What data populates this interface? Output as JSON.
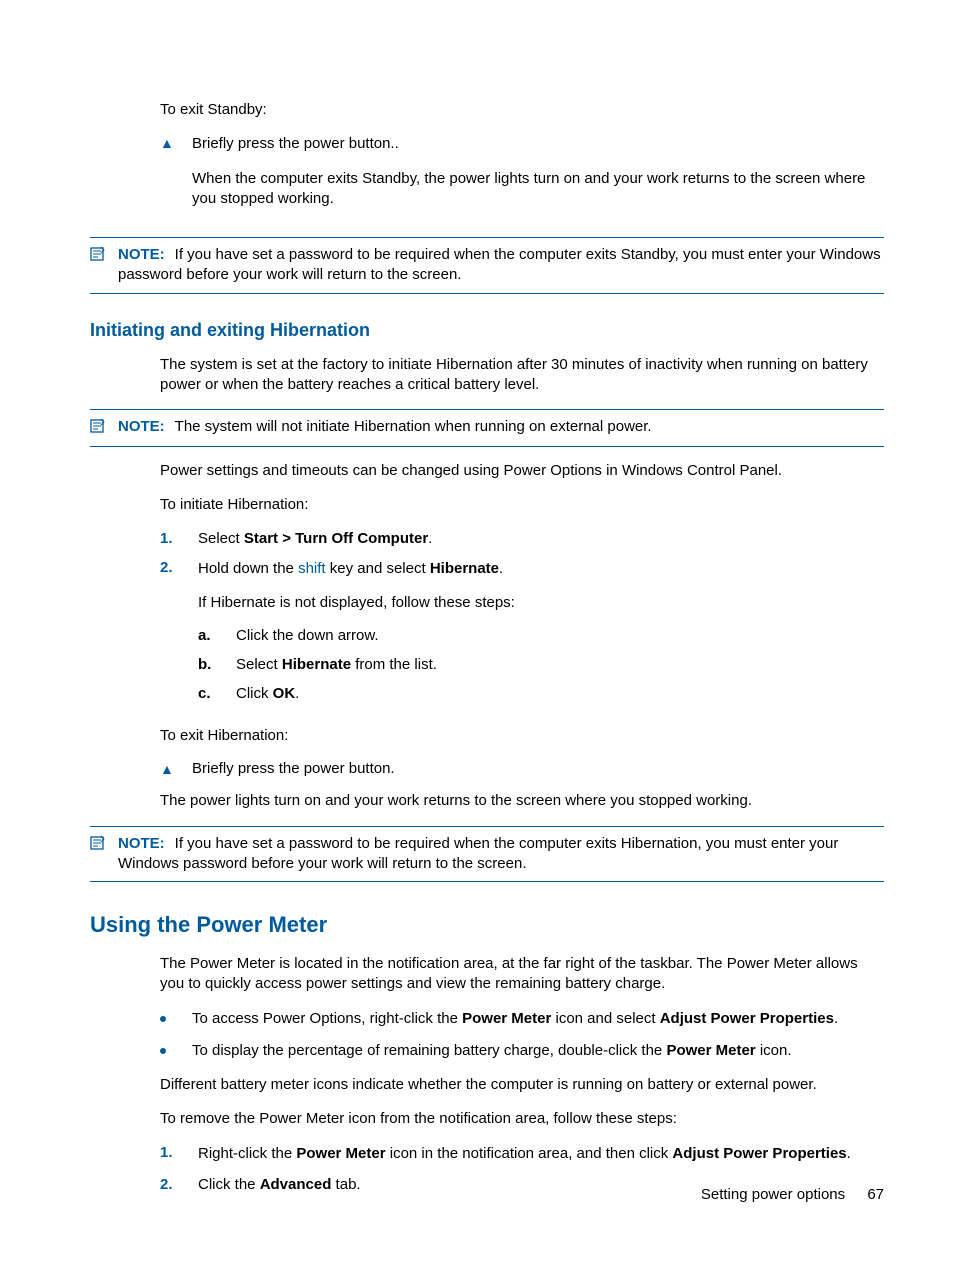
{
  "intro": {
    "exit_standby": "To exit Standby:",
    "triangle_item": "Briefly press the power button..",
    "after_exit": "When the computer exits Standby, the power lights turn on and your work returns to the screen where you stopped working."
  },
  "note1": {
    "label": "NOTE:",
    "text": "If you have set a password to be required when the computer exits Standby, you must enter your Windows password before your work will return to the screen."
  },
  "hiber": {
    "heading": "Initiating and exiting Hibernation",
    "p1": "The system is set at the factory to initiate Hibernation after 30 minutes of inactivity when running on battery power or when the battery reaches a critical battery level.",
    "note": {
      "label": "NOTE:",
      "text": "The system will not initiate Hibernation when running on external power."
    },
    "p2": "Power settings and timeouts can be changed using Power Options in Windows Control Panel.",
    "p3": "To initiate Hibernation:",
    "step1_pre": "Select ",
    "step1_bold": "Start > Turn Off Computer",
    "step1_post": ".",
    "step2_pre": "Hold down the ",
    "step2_key": "shift",
    "step2_mid": " key and select ",
    "step2_bold": "Hibernate",
    "step2_post": ".",
    "if_not": "If Hibernate is not displayed, follow these steps:",
    "sub_a": "Click the down arrow.",
    "sub_b_pre": "Select ",
    "sub_b_bold": "Hibernate",
    "sub_b_post": " from the list.",
    "sub_c_pre": "Click ",
    "sub_c_bold": "OK",
    "sub_c_post": ".",
    "to_exit": "To exit Hibernation:",
    "exit_triangle": "Briefly press the power button.",
    "after_exit": "The power lights turn on and your work returns to the screen where you stopped working.",
    "note3": {
      "label": "NOTE:",
      "text": "If you have set a password to be required when the computer exits Hibernation, you must enter your Windows password before your work will return to the screen."
    }
  },
  "pm": {
    "heading": "Using the Power Meter",
    "p1": "The Power Meter is located in the notification area, at the far right of the taskbar. The Power Meter allows you to quickly access power settings and view the remaining battery charge.",
    "b1_pre": "To access Power Options, right-click the ",
    "b1_bold1": "Power Meter",
    "b1_mid": " icon and select ",
    "b1_bold2": "Adjust Power Properties",
    "b1_post": ".",
    "b2_pre": "To display the percentage of remaining battery charge, double-click the ",
    "b2_bold": "Power Meter",
    "b2_post": " icon.",
    "p2": "Different battery meter icons indicate whether the computer is running on battery or external power.",
    "p3": "To remove the Power Meter icon from the notification area, follow these steps:",
    "s1_pre": "Right-click the ",
    "s1_bold1": "Power Meter",
    "s1_mid": " icon in the notification area, and then click ",
    "s1_bold2": "Adjust Power Properties",
    "s1_post": ".",
    "s2_pre": "Click the ",
    "s2_bold": "Advanced",
    "s2_post": " tab."
  },
  "footer": {
    "section": "Setting power options",
    "page": "67"
  },
  "markers": {
    "n1": "1.",
    "n2": "2.",
    "la": "a.",
    "lb": "b.",
    "lc": "c."
  }
}
